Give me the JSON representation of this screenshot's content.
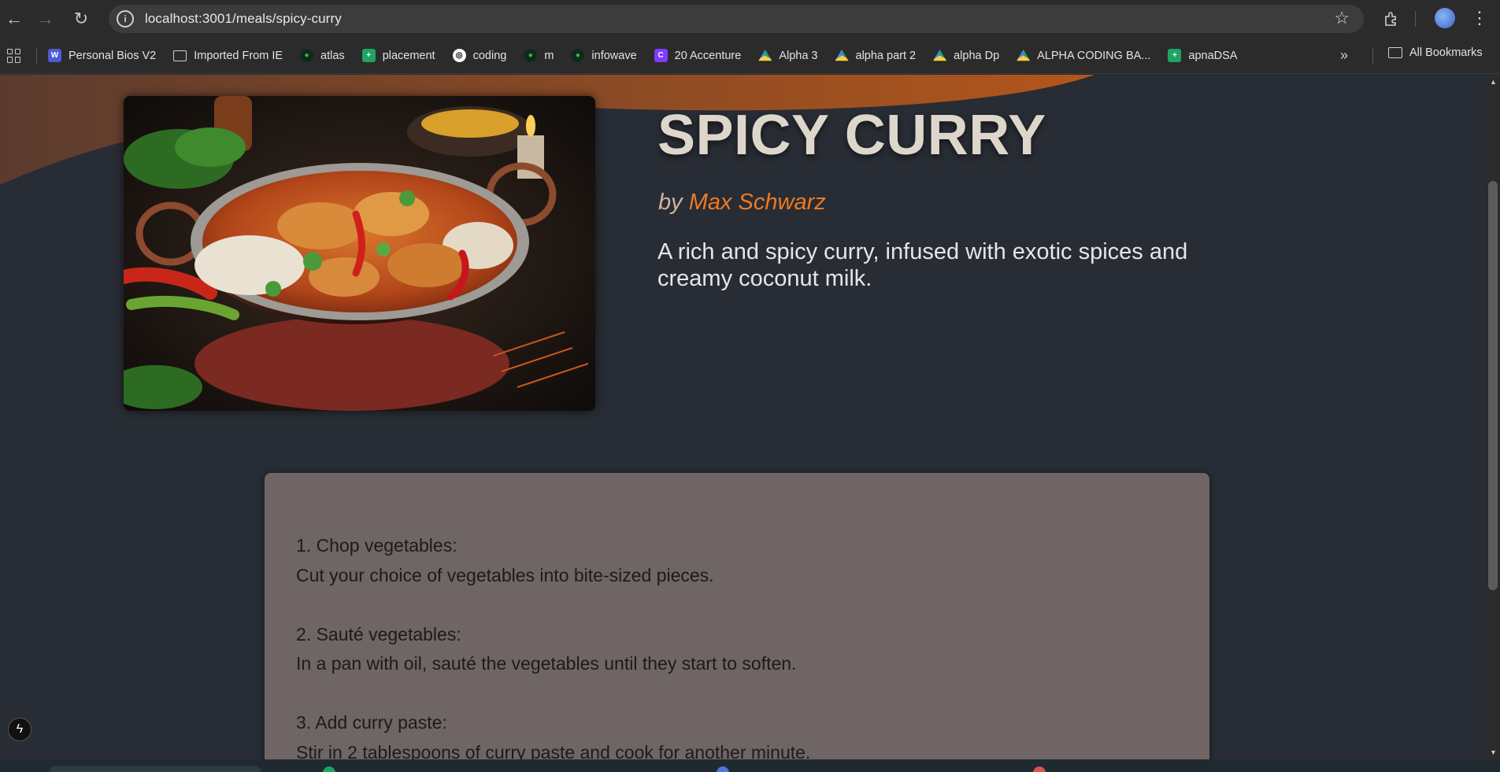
{
  "browser": {
    "url": "localhost:3001/meals/spicy-curry",
    "nav": {
      "back_icon": "←",
      "forward_icon": "→",
      "reload_icon": "↻"
    },
    "bookmarks": [
      {
        "label": "Personal Bios V2",
        "icon": "bio"
      },
      {
        "label": "Imported From IE",
        "icon": "folder"
      },
      {
        "label": "atlas",
        "icon": "mongo"
      },
      {
        "label": "placement",
        "icon": "sheet"
      },
      {
        "label": "coding",
        "icon": "gpt"
      },
      {
        "label": "m",
        "icon": "mongo"
      },
      {
        "label": "infowave",
        "icon": "mongo"
      },
      {
        "label": "20 Accenture",
        "icon": "canva"
      },
      {
        "label": "Alpha 3",
        "icon": "drive"
      },
      {
        "label": "alpha part 2",
        "icon": "drive"
      },
      {
        "label": "alpha Dp",
        "icon": "drive"
      },
      {
        "label": "ALPHA CODING BA...",
        "icon": "drive"
      },
      {
        "label": "apnaDSA",
        "icon": "sheet"
      }
    ],
    "bookmarks_overflow": "»",
    "all_bookmarks": "All Bookmarks"
  },
  "meal": {
    "title": "SPICY CURRY",
    "by_prefix": "by",
    "creator": "Max Schwarz",
    "summary": "A rich and spicy curry, infused with exotic spices and creamy coconut milk.",
    "image_alt": "Spicy Curry",
    "instructions": [
      {
        "heading": "1. Chop vegetables:",
        "text": "Cut your choice of vegetables into bite-sized pieces."
      },
      {
        "heading": "2. Sauté vegetables:",
        "text": "In a pan with oil, sauté the vegetables until they start to soften."
      },
      {
        "heading": "3. Add curry paste:",
        "text": "Stir in 2 tablespoons of curry paste and cook for another minute."
      }
    ]
  },
  "colors": {
    "page_bg": "#282c34",
    "accent": "#f07a22",
    "title": "#ddd6cb",
    "card_bg": "#6e6564"
  }
}
